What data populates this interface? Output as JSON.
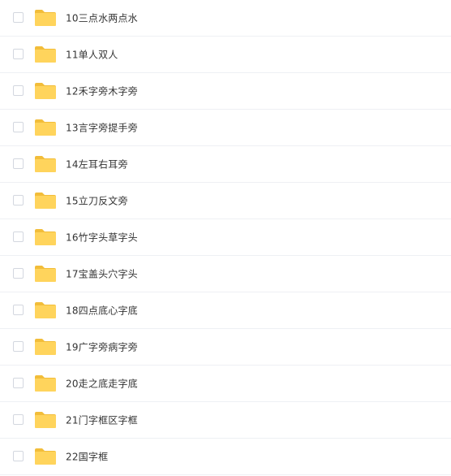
{
  "files": [
    {
      "name": "10三点水两点水",
      "icon": "folder-icon",
      "checked": false
    },
    {
      "name": "11单人双人",
      "icon": "folder-icon",
      "checked": false
    },
    {
      "name": "12禾字旁木字旁",
      "icon": "folder-icon",
      "checked": false
    },
    {
      "name": "13言字旁提手旁",
      "icon": "folder-icon",
      "checked": false
    },
    {
      "name": "14左耳右耳旁",
      "icon": "folder-icon",
      "checked": false
    },
    {
      "name": "15立刀反文旁",
      "icon": "folder-icon",
      "checked": false
    },
    {
      "name": "16竹字头草字头",
      "icon": "folder-icon",
      "checked": false
    },
    {
      "name": "17宝盖头穴字头",
      "icon": "folder-icon",
      "checked": false
    },
    {
      "name": "18四点底心字底",
      "icon": "folder-icon",
      "checked": false
    },
    {
      "name": "19广字旁病字旁",
      "icon": "folder-icon",
      "checked": false
    },
    {
      "name": "20走之底走字底",
      "icon": "folder-icon",
      "checked": false
    },
    {
      "name": "21门字框区字框",
      "icon": "folder-icon",
      "checked": false
    },
    {
      "name": "22国字框",
      "icon": "folder-icon",
      "checked": false
    }
  ],
  "colors": {
    "folder_back": "#f7c948",
    "folder_front": "#ffd864",
    "divider": "#eef0f4",
    "text": "#333333"
  }
}
